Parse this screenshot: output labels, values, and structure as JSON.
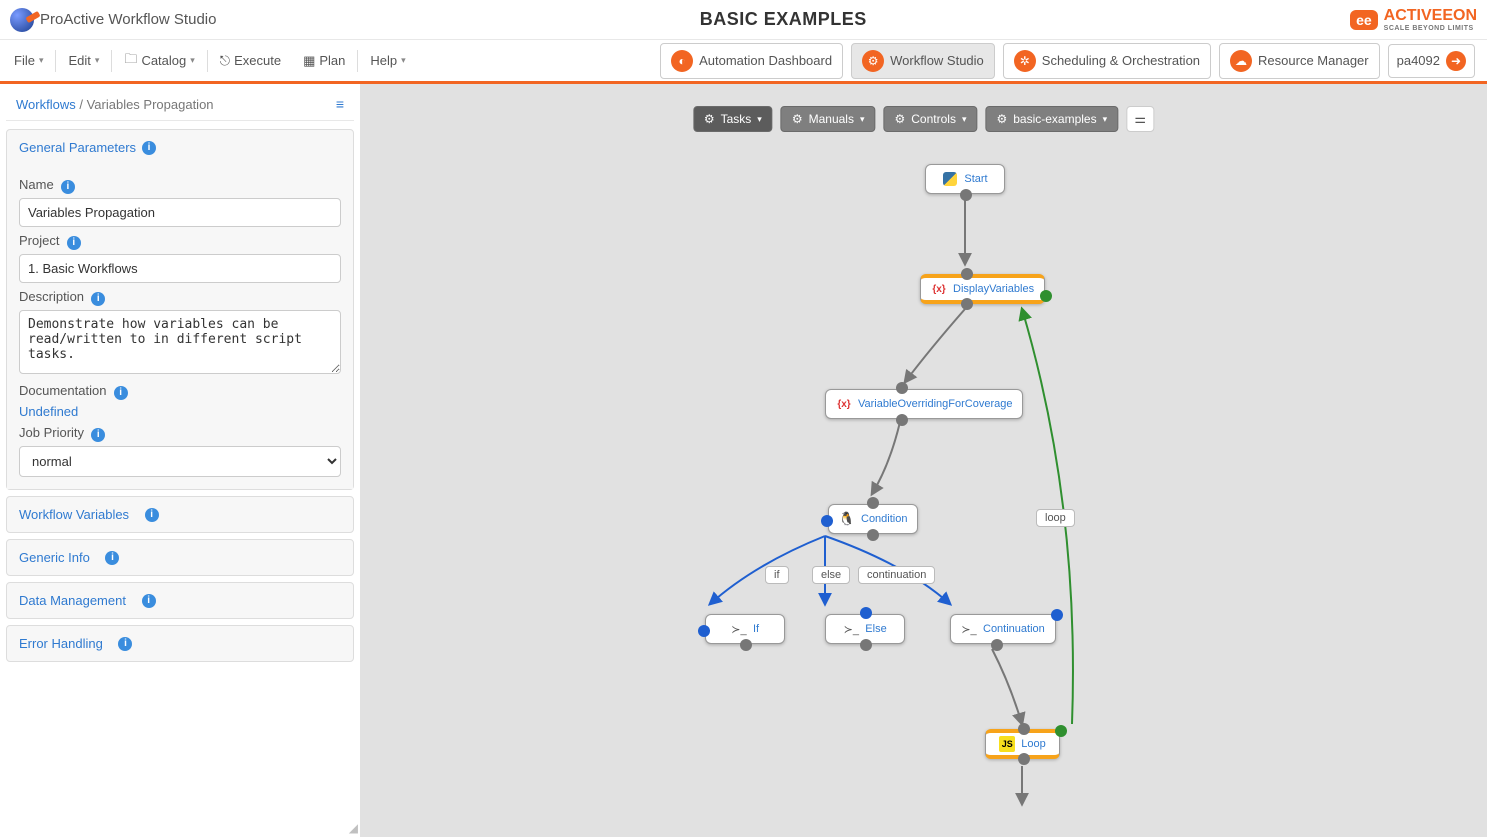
{
  "header": {
    "app_name": "ProActive Workflow Studio",
    "title": "BASIC EXAMPLES",
    "vendor": "ACTIVEEON",
    "vendor_tag": "SCALE BEYOND LIMITS"
  },
  "menubar": {
    "file": "File",
    "edit": "Edit",
    "catalog": "Catalog",
    "execute": "Execute",
    "plan": "Plan",
    "help": "Help"
  },
  "nav": {
    "automation": "Automation Dashboard",
    "studio": "Workflow Studio",
    "scheduling": "Scheduling & Orchestration",
    "resource": "Resource Manager",
    "user": "pa4092"
  },
  "breadcrumb": {
    "root": "Workflows",
    "current": "Variables Propagation"
  },
  "panels": {
    "general": {
      "title": "General Parameters",
      "name_label": "Name",
      "name_value": "Variables Propagation",
      "project_label": "Project",
      "project_value": "1. Basic Workflows",
      "description_label": "Description",
      "description_value": "Demonstrate how variables can be read/written to in different script tasks.",
      "documentation_label": "Documentation",
      "documentation_value": "Undefined",
      "priority_label": "Job Priority",
      "priority_value": "normal"
    },
    "workflow_vars": "Workflow Variables",
    "generic_info": "Generic Info",
    "data_mgmt": "Data Management",
    "error_handling": "Error Handling"
  },
  "palette": {
    "tasks": "Tasks",
    "manuals": "Manuals",
    "controls": "Controls",
    "basic": "basic-examples"
  },
  "nodes": {
    "start": "Start",
    "display": "DisplayVariables",
    "override": "VariableOverridingForCoverage",
    "condition": "Condition",
    "if": "If",
    "else": "Else",
    "cont": "Continuation",
    "loop": "Loop"
  },
  "branch_labels": {
    "if": "if",
    "else": "else",
    "continuation": "continuation",
    "loop": "loop"
  }
}
